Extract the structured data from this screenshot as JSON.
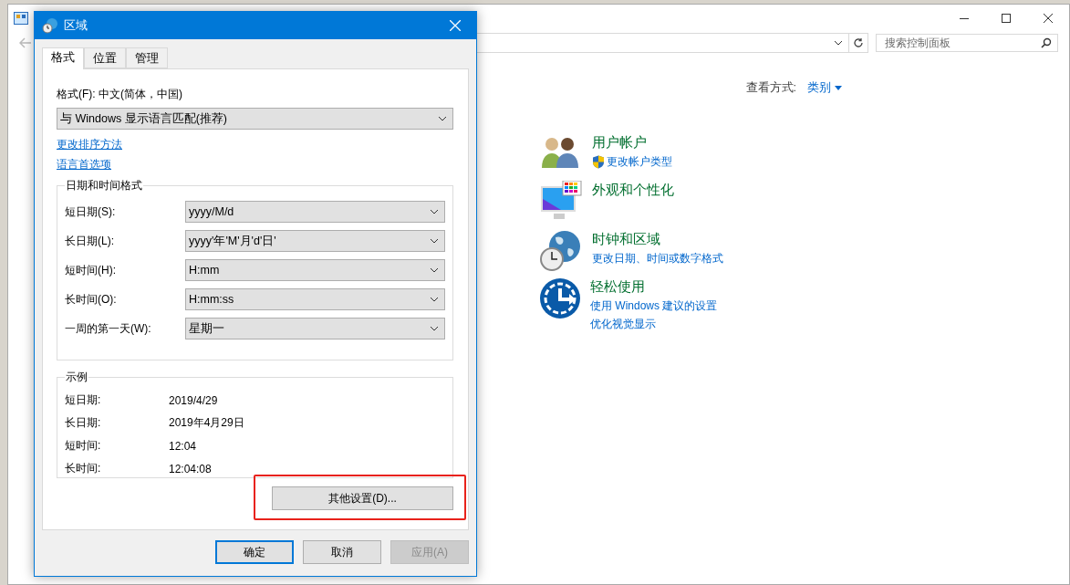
{
  "control_panel": {
    "search": {
      "placeholder": "搜索控制面板"
    },
    "view_by": {
      "label": "查看方式:",
      "value": "类别"
    },
    "categories": [
      {
        "kind": "users",
        "title": "用户帐户",
        "links": [
          {
            "text": "更改帐户类型",
            "shield": true
          }
        ]
      },
      {
        "kind": "appearance",
        "title": "外观和个性化"
      },
      {
        "kind": "clock",
        "title": "时钟和区域",
        "links": [
          {
            "text": "更改日期、时间或数字格式",
            "shield": false
          }
        ]
      },
      {
        "kind": "ease",
        "title": "轻松使用",
        "links": [
          {
            "text": "使用 Windows 建议的设置",
            "shield": false
          },
          {
            "text": "优化视觉显示",
            "shield": false
          }
        ]
      }
    ]
  },
  "dialog": {
    "title": "区域",
    "tabs": [
      {
        "label": "格式",
        "selected": true
      },
      {
        "label": "位置",
        "selected": false
      },
      {
        "label": "管理",
        "selected": false
      }
    ],
    "format_label": "格式(F): 中文(简体，中国)",
    "format_select": "与 Windows 显示语言匹配(推荐)",
    "links": [
      "更改排序方法",
      "语言首选项"
    ],
    "formats_group": {
      "title": "日期和时间格式",
      "fields": [
        {
          "label": "短日期(S):",
          "value": "yyyy/M/d"
        },
        {
          "label": "长日期(L):",
          "value": "yyyy'年'M'月'd'日'"
        },
        {
          "label": "短时间(H):",
          "value": "H:mm"
        },
        {
          "label": "长时间(O):",
          "value": "H:mm:ss"
        },
        {
          "label": "一周的第一天(W):",
          "value": "星期一"
        }
      ]
    },
    "example_group": {
      "title": "示例",
      "rows": [
        {
          "label": "短日期:",
          "value": "2019/4/29"
        },
        {
          "label": "长日期:",
          "value": "2019年4月29日"
        },
        {
          "label": "短时间:",
          "value": "12:04"
        },
        {
          "label": "长时间:",
          "value": "12:04:08"
        }
      ]
    },
    "other_settings": {
      "label": "其他设置(D)...",
      "highlighted": true
    },
    "buttons": [
      {
        "label": "确定",
        "default": true,
        "disabled": false
      },
      {
        "label": "取消",
        "default": false,
        "disabled": false
      },
      {
        "label": "应用(A)",
        "default": false,
        "disabled": true
      }
    ]
  }
}
